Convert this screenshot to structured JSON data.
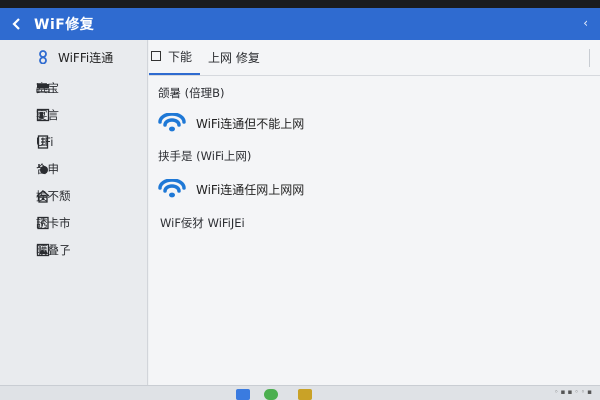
{
  "window": {
    "title": "WiF修复"
  },
  "colors": {
    "accent": "#2f6bd0",
    "wifi_icon": "#1e78d6"
  },
  "sidebar": {
    "items": [
      {
        "label": "WiFFi连通",
        "icon": "wifi-connect-icon"
      },
      {
        "label": "赛宝",
        "icon": "device-icon"
      },
      {
        "label": "宴言",
        "icon": "message-icon"
      },
      {
        "label": "UFi",
        "icon": "storage-icon"
      },
      {
        "label": "合申",
        "icon": "settings-icon"
      },
      {
        "label": "挨不颓",
        "icon": "home-icon"
      },
      {
        "label": "誘卡市",
        "icon": "card-icon"
      },
      {
        "label": "曠叠孒",
        "icon": "image-icon"
      }
    ]
  },
  "tabs": [
    {
      "label": "下能"
    },
    {
      "label": "上网 修复"
    }
  ],
  "content": {
    "heading1": "颌暑 (倍理B)",
    "option1": "WiFi连通但不能上网",
    "heading2": "挟手是 (WiFi上网)",
    "option2": "WiFi连通任网上网网",
    "footer": "WiF佞犲 WiFiJEi"
  }
}
